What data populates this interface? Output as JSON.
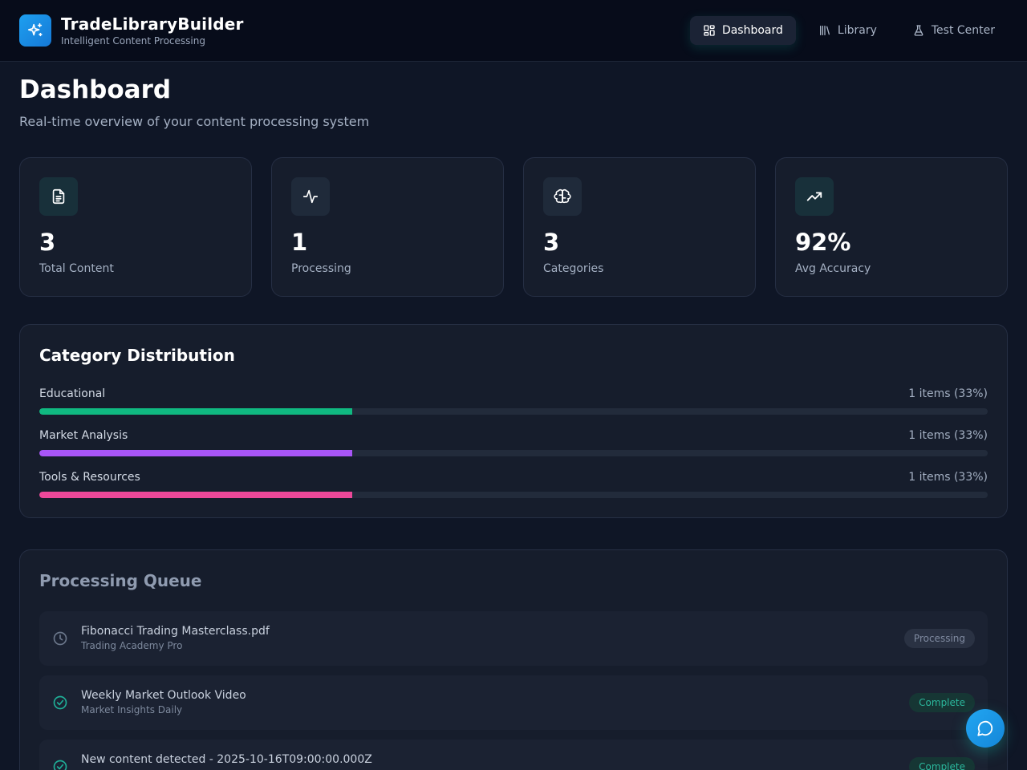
{
  "brand": {
    "title": "TradeLibraryBuilder",
    "subtitle": "Intelligent Content Processing",
    "logo_icon": "sparkles-icon"
  },
  "nav": [
    {
      "label": "Dashboard",
      "icon": "dashboard-grid-icon",
      "active": true
    },
    {
      "label": "Library",
      "icon": "library-icon",
      "active": false
    },
    {
      "label": "Test Center",
      "icon": "flask-icon",
      "active": false
    }
  ],
  "page": {
    "title": "Dashboard",
    "subtitle": "Real-time overview of your content processing system"
  },
  "stats": [
    {
      "value": "3",
      "label": "Total Content",
      "icon": "document-icon"
    },
    {
      "value": "1",
      "label": "Processing",
      "icon": "activity-icon"
    },
    {
      "value": "3",
      "label": "Categories",
      "icon": "brain-icon"
    },
    {
      "value": "92%",
      "label": "Avg Accuracy",
      "icon": "trending-up-icon"
    }
  ],
  "distribution": {
    "title": "Category Distribution",
    "items": [
      {
        "name": "Educational",
        "count_text": "1 items (33%)",
        "fraction": 0.33,
        "color": "#10b981"
      },
      {
        "name": "Market Analysis",
        "count_text": "1 items (33%)",
        "fraction": 0.33,
        "color": "#a855f7"
      },
      {
        "name": "Tools & Resources",
        "count_text": "1 items (33%)",
        "fraction": 0.33,
        "color": "#ec4899"
      }
    ]
  },
  "queue": {
    "title": "Processing Queue",
    "items": [
      {
        "title": "Fibonacci Trading Masterclass.pdf",
        "source": "Trading Academy Pro",
        "status": "Processing",
        "icon": "clock-icon"
      },
      {
        "title": "Weekly Market Outlook Video",
        "source": "Market Insights Daily",
        "status": "Complete",
        "icon": "check-circle-icon"
      },
      {
        "title": "New content detected - 2025-10-16T09:00:00.000Z",
        "source": "",
        "status": "Complete",
        "icon": "check-circle-icon"
      }
    ]
  },
  "chat": {
    "icon": "chat-bubble-icon"
  },
  "colors": {
    "accent": "#1e9ff0",
    "teal": "#14b8a6",
    "background": "#0f1626",
    "card": "#161d2c"
  }
}
